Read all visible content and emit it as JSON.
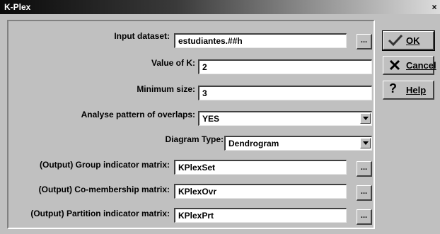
{
  "window": {
    "title": "K-Plex",
    "close_glyph": "×"
  },
  "fields": {
    "input_dataset": {
      "label": "Input dataset:",
      "value": "estudiantes.##h",
      "browse": "..."
    },
    "value_of_k": {
      "label": "Value of K:",
      "value": "2"
    },
    "minimum_size": {
      "label": "Minimum size:",
      "value": "3"
    },
    "analyse_overlaps": {
      "label": "Analyse pattern of overlaps:",
      "value": "YES"
    },
    "diagram_type": {
      "label": "Diagram Type:",
      "value": "Dendrogram"
    },
    "group_indicator": {
      "label": "(Output) Group indicator matrix:",
      "value": "KPlexSet",
      "browse": "..."
    },
    "comembership": {
      "label": "(Output) Co-membership matrix:",
      "value": "KPlexOvr",
      "browse": "..."
    },
    "partition_indicator": {
      "label": "(Output) Partition indicator matrix:",
      "value": "KPlexPrt",
      "browse": "..."
    }
  },
  "buttons": {
    "ok": {
      "label": "OK",
      "icon": "checkmark-icon"
    },
    "cancel": {
      "label": "Cancel",
      "icon": "x-icon"
    },
    "help": {
      "label": "Help",
      "icon": "question-icon"
    }
  },
  "colors": {
    "face": "#c0c0c0",
    "title_start": "#0a0a0a",
    "title_end": "#dcdcdc"
  }
}
